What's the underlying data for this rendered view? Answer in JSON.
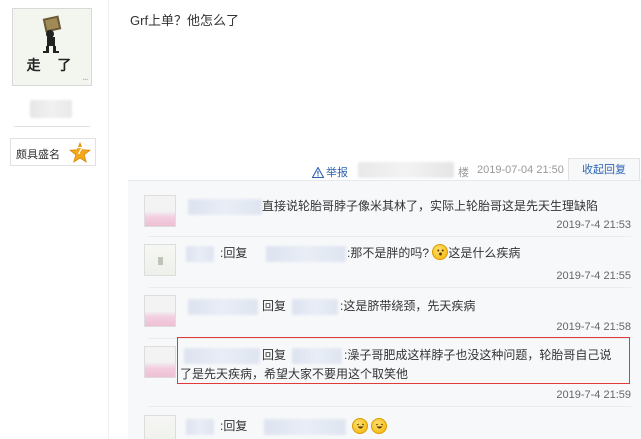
{
  "user": {
    "avatar_text": "走 了",
    "badge_label": "颇具盛名",
    "badge_level": "7"
  },
  "post": {
    "text": "Grf上单？他怎么了"
  },
  "meta": {
    "report_label": "举报",
    "floor_label": "楼",
    "date": "2019-07-04 21:50",
    "collapse_label": "收起回复"
  },
  "replies": [
    {
      "text": "直接说轮胎哥脖子像米其林了，实际上轮胎哥这是先天生理缺陷",
      "time": "2019-7-4 21:53"
    },
    {
      "prefix": ":回复",
      "text": ":那不是胖的吗?",
      "text2": "这是什么疾病",
      "time": "2019-7-4 21:55",
      "emoji": "surprised-emoji"
    },
    {
      "prefix": "回复",
      "text": ":这是脐带绕颈，先天疾病",
      "time": "2019-7-4 21:58"
    },
    {
      "prefix": "回复",
      "text": ":澡子哥肥成这样脖子也没这种问题，轮胎哥自己说",
      "text_line2": "了是先天疾病，希望大家不要用这个取笑他",
      "time": "2019-7-4 21:59"
    },
    {
      "prefix": ":回复",
      "emoji": "laughing-emoji"
    }
  ],
  "colors": {
    "link": "#2d64b3",
    "highlight": "#e03a3a",
    "reply_bg": "#f7f8fa"
  }
}
